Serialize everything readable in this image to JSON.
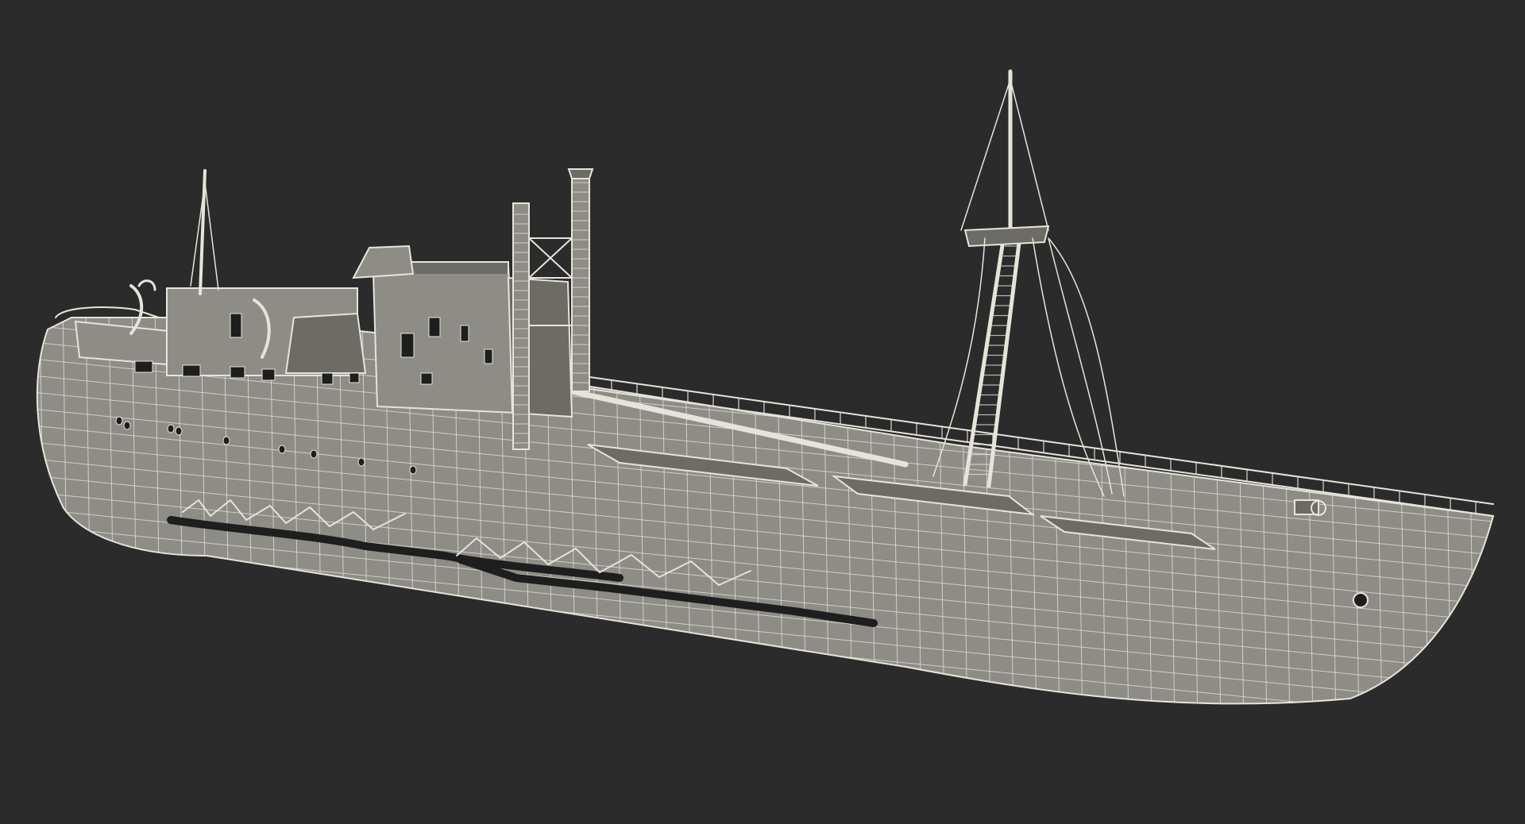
{
  "scene": {
    "subject": "ship-wireframe",
    "colors": {
      "background": "#2b2b2b",
      "wire": "#e6e4da",
      "fill": "#8e8c86",
      "fill_dark": "#6d6b66",
      "window": "#1e1e1e"
    }
  }
}
